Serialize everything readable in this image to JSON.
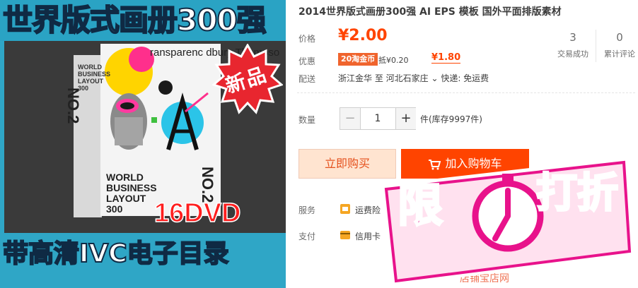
{
  "product_image": {
    "top_banner": "世界版式画册300强",
    "bottom_banner": "带高清IVC电子目录",
    "box_left_title": "WORLD BUSINESS LAYOUT 300",
    "box_left_num": "NO.2",
    "box_script": "ransparenc dbury Thompso",
    "box_bottom_title": "WORLD BUSINESS LAYOUT 300",
    "box_right_num": "NO.2",
    "new_badge": "新品",
    "dvd": "16DVD"
  },
  "detail": {
    "title": "2014世界版式画册300强 AI EPS 模板 国外平面排版素材",
    "price_label": "价格",
    "price": "¥2.00",
    "sales_count": "3",
    "sales_label": "交易成功",
    "review_count": "0",
    "review_label": "累计评论",
    "promo_label": "优惠",
    "coin_tag": "20淘金币",
    "deduct": "抵¥0.20",
    "final_price": "¥1.80",
    "ship_label": "配送",
    "ship_text": "浙江金华  至  河北石家庄 ⌄  快递: 免运费",
    "qty_label": "数量",
    "qty_minus": "−",
    "qty_value": "1",
    "qty_plus": "+",
    "stock": "件(库存9997件)",
    "buy_now": "立即购买",
    "add_cart": "加入购物车",
    "service_label": "服务",
    "service_text": "运费险",
    "pay_label": "支付",
    "pay_text": "信用卡",
    "bottom_faint": "店铺宝店网"
  },
  "promo_sticker": {
    "char1": "限",
    "char2": "打折"
  },
  "colors": {
    "accent": "#ff4400",
    "price": "#ff4400",
    "promo_pink": "#e8128b",
    "banner_blue": "#2aa3c4"
  }
}
